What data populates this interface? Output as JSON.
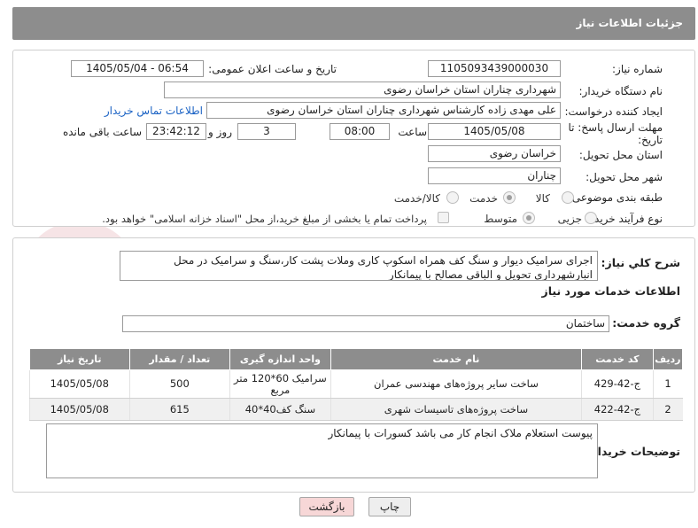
{
  "header": {
    "title": "جزئیات اطلاعات نیاز"
  },
  "form": {
    "need_number": {
      "label": "شماره نیاز:",
      "value": "1105093439000030"
    },
    "announce": {
      "label": "تاریخ و ساعت اعلان عمومی:",
      "value": "1405/05/04 - 06:54"
    },
    "buyer_org": {
      "label": "نام دستگاه خریدار:",
      "value": "شهرداری چناران استان خراسان رضوی"
    },
    "creator": {
      "label": "ایجاد کننده درخواست:",
      "value": "علی مهدی زاده کارشناس شهرداری چناران استان خراسان رضوی",
      "contact_link": "اطلاعات تماس خریدار"
    },
    "deadline": {
      "label1": "مهلت ارسال پاسخ: تا",
      "label2": "تاریخ:",
      "date": "1405/05/08",
      "time_label": "ساعت",
      "time": "08:00",
      "days": "3",
      "days_label": "روز و",
      "remaining": "23:42:12",
      "remaining_label": "ساعت باقی مانده"
    },
    "province": {
      "label": "استان محل تحویل:",
      "value": "خراسان رضوی"
    },
    "city": {
      "label": "شهر محل تحویل:",
      "value": "چناران"
    },
    "category": {
      "label": "طبقه بندی موضوعی:",
      "options": [
        "کالا",
        "خدمت",
        "کالا/خدمت"
      ],
      "selected": "خدمت"
    },
    "process": {
      "label": "نوع فرآیند خرید :",
      "options": [
        "جزیی",
        "متوسط"
      ],
      "selected": "متوسط",
      "note": "پرداخت تمام یا بخشی از مبلغ خرید،از محل \"اسناد خزانه اسلامی\" خواهد بود."
    }
  },
  "description": {
    "label": "شرح کلي نياز:",
    "text": "اجرای سرامیک دیوار و سنگ کف همراه اسکوپ کاری وملات پشت کار،سنگ و سرامیک در محل انبارشهرداری تحویل و الباقی مصالح با پیمانکار"
  },
  "services": {
    "section_title": "اطلاعات خدمات مورد نیاز",
    "group_label": "گروه خدمت:",
    "group_value": "ساختمان",
    "columns": [
      "ردیف",
      "کد خدمت",
      "نام خدمت",
      "واحد اندازه گیری",
      "تعداد / مقدار",
      "تاریخ نیاز"
    ],
    "rows": [
      {
        "n": "1",
        "code": "ج-42-429",
        "name": "ساخت سایر پروژه‌های مهندسی عمران",
        "unit": "سرامیک 60*120 متر مربع",
        "qty": "500",
        "date": "1405/05/08"
      },
      {
        "n": "2",
        "code": "ج-42-422",
        "name": "ساخت پروژه‌های تاسیسات شهری",
        "unit": "سنگ کف40*40",
        "qty": "615",
        "date": "1405/05/08"
      }
    ]
  },
  "buyer_notes": {
    "label": "توضیحات خریدار:",
    "text": "پیوست استعلام ملاک انجام کار می باشد کسورات با پیمانکار"
  },
  "buttons": {
    "print": "چاپ",
    "back": "بازگشت"
  },
  "watermark": {
    "text": "AriaTender.net"
  },
  "colors": {
    "header_bg": "#8d8d8d",
    "link": "#1a62c4",
    "back_button": "#f7d7d7"
  }
}
